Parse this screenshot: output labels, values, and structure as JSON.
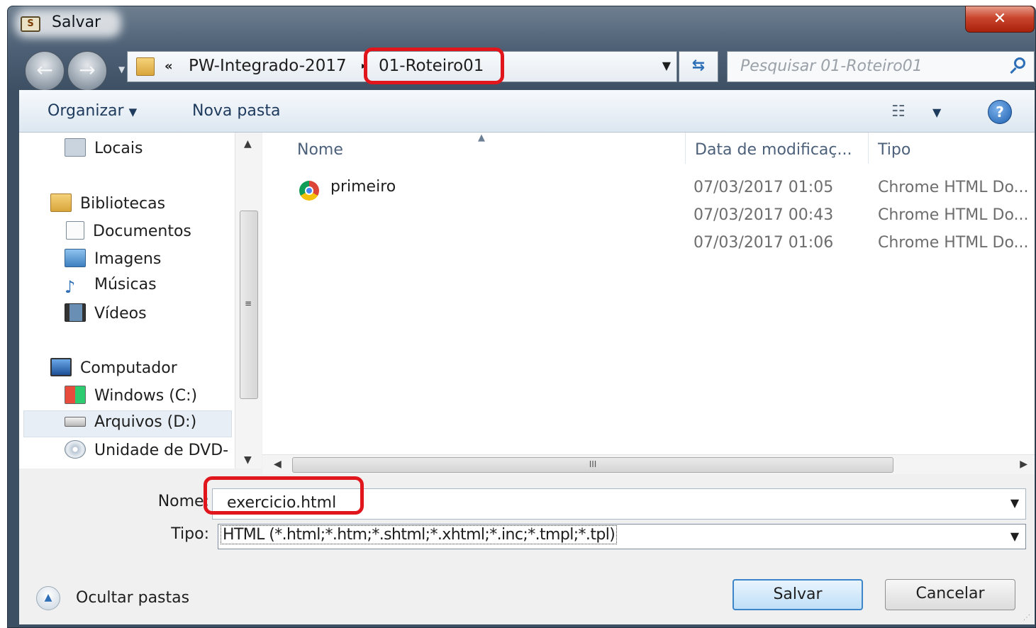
{
  "window": {
    "title": "Salvar",
    "close_glyph": "✕"
  },
  "nav": {
    "back_icon": "back-arrow-icon",
    "forward_icon": "forward-arrow-icon"
  },
  "address": {
    "overflow": "«",
    "crumbs": [
      "PW-Integrado-2017",
      "01-Roteiro01"
    ],
    "separator": "▸"
  },
  "search": {
    "placeholder": "Pesquisar 01-Roteiro01"
  },
  "toolbar": {
    "organize_label": "Organizar",
    "new_folder_label": "Nova pasta"
  },
  "sidebar": {
    "items": [
      {
        "label": "Locais",
        "icon": "recent-places-icon"
      },
      {
        "label": "Bibliotecas",
        "icon": "libraries-icon"
      },
      {
        "label": "Documentos",
        "icon": "documents-icon"
      },
      {
        "label": "Imagens",
        "icon": "pictures-icon"
      },
      {
        "label": "Músicas",
        "icon": "music-icon"
      },
      {
        "label": "Vídeos",
        "icon": "videos-icon"
      },
      {
        "label": "Computador",
        "icon": "computer-icon"
      },
      {
        "label": "Windows (C:)",
        "icon": "windows-drive-icon"
      },
      {
        "label": "Arquivos (D:)",
        "icon": "hard-drive-icon"
      },
      {
        "label": "Unidade de DVD-",
        "icon": "dvd-drive-icon"
      }
    ],
    "selected": "Arquivos (D:)"
  },
  "file_list": {
    "columns": [
      "Nome",
      "Data de modificaç...",
      "Tipo"
    ],
    "rows": [
      {
        "name": "primeiro",
        "modified": "07/03/2017 01:05",
        "type": "Chrome HTML Do..."
      },
      {
        "name": "",
        "modified": "07/03/2017 00:43",
        "type": "Chrome HTML Do..."
      },
      {
        "name": "",
        "modified": "07/03/2017 01:06",
        "type": "Chrome HTML Do..."
      }
    ],
    "hscroll_grip": "III"
  },
  "form": {
    "name_label": "Nome:",
    "name_value": "exercicio.html",
    "type_label": "Tipo:",
    "type_value": "HTML (*.html;*.htm;*.shtml;*.xhtml;*.inc;*.tmpl;*.tpl)"
  },
  "footer": {
    "hide_folders_label": "Ocultar pastas",
    "save_label": "Salvar",
    "cancel_label": "Cancelar"
  },
  "colors": {
    "callout": "#e1161d",
    "accent": "#3c85c8"
  }
}
